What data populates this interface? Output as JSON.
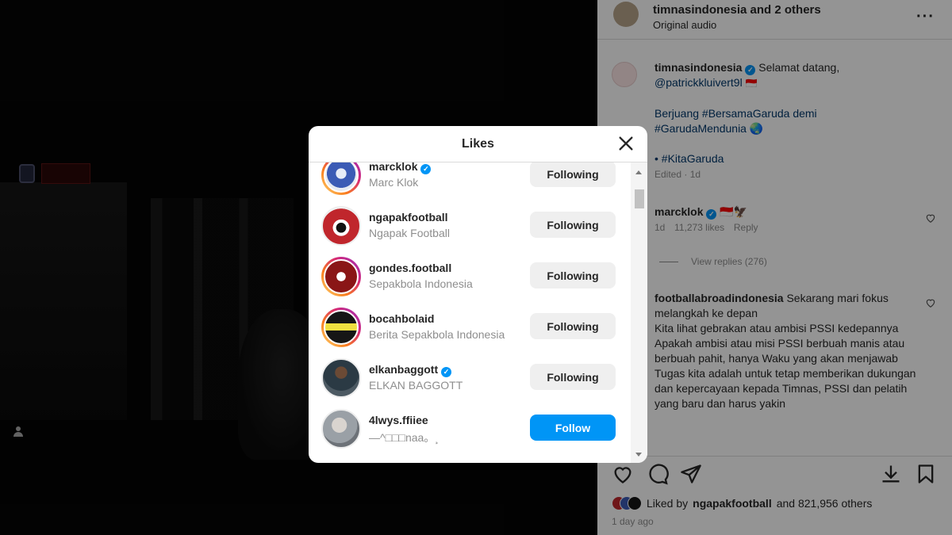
{
  "side": {
    "header_title": "timnasindonesia and 2 others",
    "header_sub": "Original audio",
    "more_icon": "···",
    "caption_user": "timnasindonesia",
    "caption_lines": [
      "Selamat datang,",
      "@patrickkluivert9l",
      "Berjuang #BersamaGaruda demi",
      "#GarudaMendunia",
      "• #KitaGaruda"
    ],
    "caption_meta": "Edited · 1d",
    "comment1_user": "marcklok",
    "comment1_meta": [
      "1d",
      "11,273 likes",
      "Reply"
    ],
    "view_replies": "View replies (276)",
    "comment2_user": "footballabroadindonesia",
    "comment2_text": "Sekarang mari fokus melangkah ke depan\nKita lihat gebrakan atau ambisi PSSI kedepannya\nApakah ambisi atau misi PSSI berbuah manis atau berbuah pahit, hanya Waku yang akan menjawab\nTugas kita adalah untuk tetap memberikan dukungan dan kepercayaan kepada Timnas, PSSI dan pelatih yang baru dan harus yakin",
    "liked_by_prefix": "Liked by",
    "liked_by_user": "ngapakfootball",
    "liked_by_suffix": "and 821,956 others",
    "time_ago": "1 day ago"
  },
  "modal": {
    "title": "Likes",
    "users": [
      {
        "username": "marcklok",
        "fullname": "Marc Klok",
        "verified": true,
        "button": "Following",
        "color": "#3b5bb5"
      },
      {
        "username": "ngapakfootball",
        "fullname": "Ngapak Football",
        "verified": false,
        "button": "Following",
        "color": "#c0262c"
      },
      {
        "username": "gondes.football",
        "fullname": "Sepakbola Indonesia",
        "verified": false,
        "button": "Following",
        "color": "#8a1616"
      },
      {
        "username": "bocahbolaid",
        "fullname": "Berita Sepakbola Indonesia",
        "verified": false,
        "button": "Following",
        "color": "#161616"
      },
      {
        "username": "elkanbaggott",
        "fullname": "ELKAN BAGGOTT",
        "verified": true,
        "button": "Following",
        "color": "#4d5a63"
      },
      {
        "username": "4lwys.ffiiee",
        "fullname": "—^□□□naa。¸",
        "verified": false,
        "button": "Follow",
        "color": "#9aa0a6"
      }
    ]
  },
  "colors": {
    "accent": "#0095f6",
    "following_bg": "#efefef"
  }
}
